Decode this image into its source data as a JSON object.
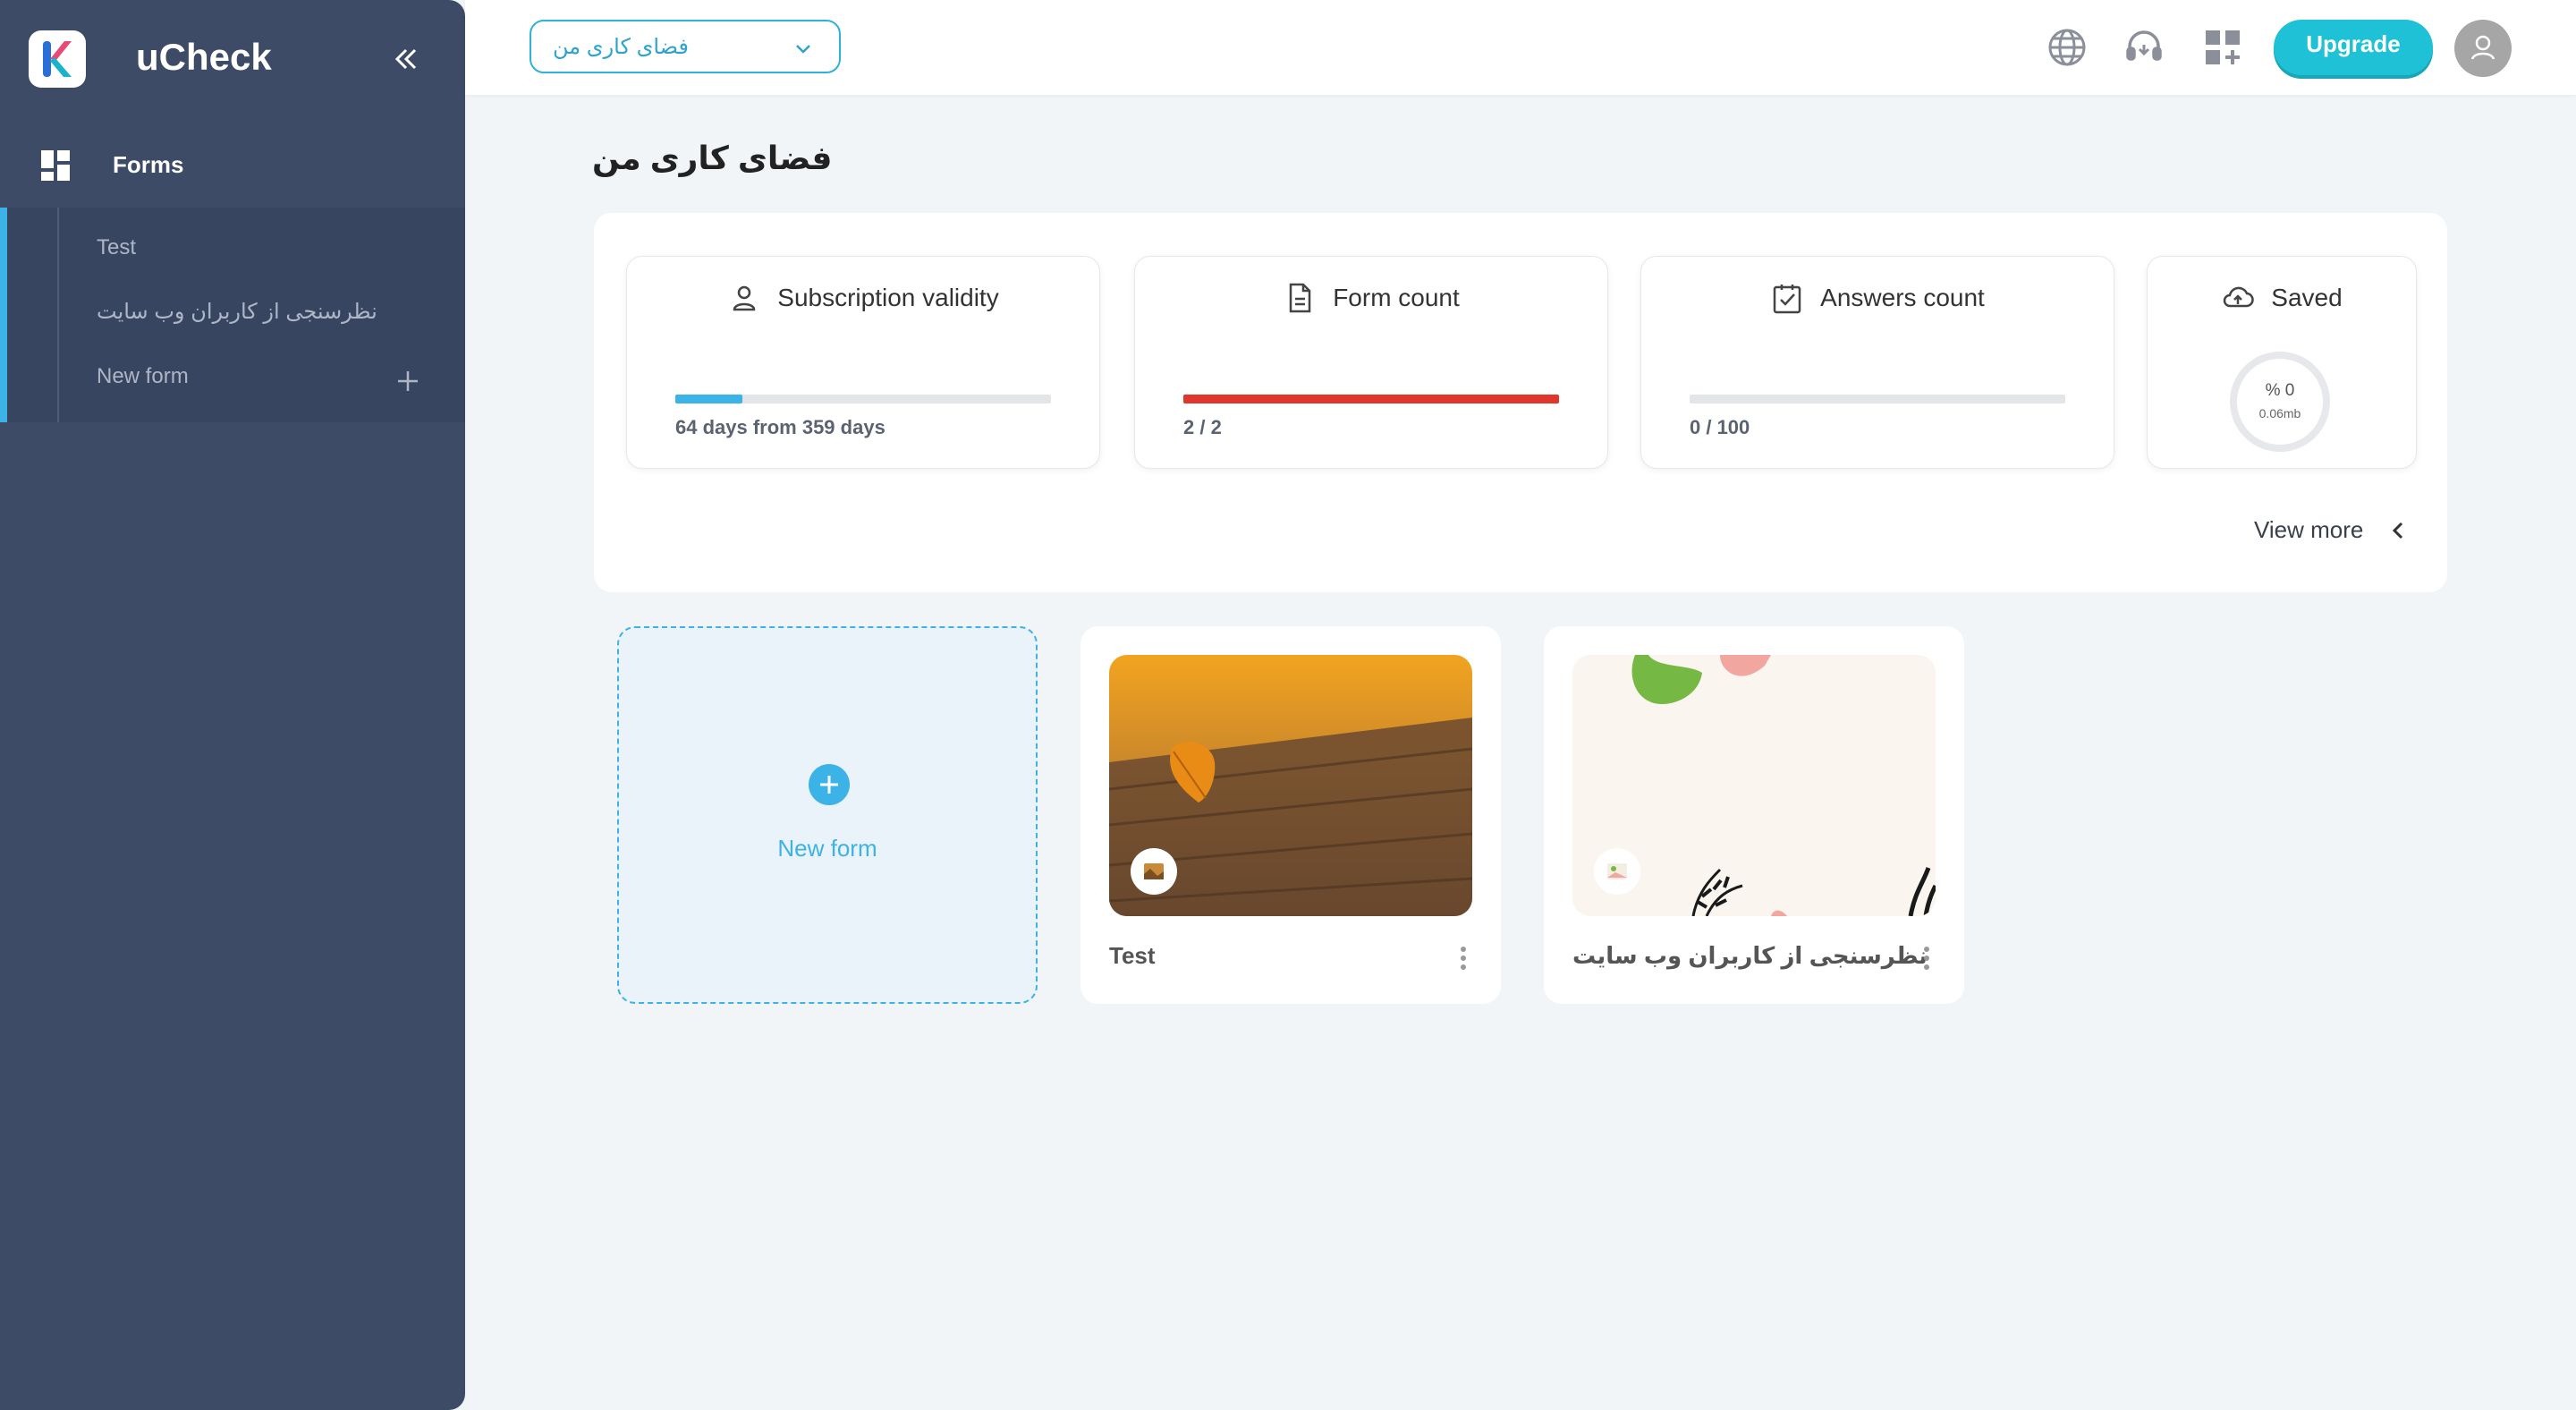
{
  "app": {
    "name": "uCheck"
  },
  "sidebar": {
    "main_item": "Forms",
    "sub_items": [
      {
        "label": "Test"
      },
      {
        "label": "نظرسنجی از کاربران وب سایت"
      },
      {
        "label": "New form"
      }
    ]
  },
  "topbar": {
    "workspace_select": "فضای کاری من",
    "upgrade_label": "Upgrade",
    "icons": [
      "globe-icon",
      "support-headset-icon",
      "apps-add-icon",
      "avatar-icon"
    ]
  },
  "page": {
    "title": "فضای کاری من"
  },
  "stats": {
    "subscription": {
      "title": "Subscription validity",
      "text": "64 days from 359 days",
      "progress": 0.178,
      "color": "#3bb3e6"
    },
    "forms": {
      "title": "Form count",
      "text": "2 / 2",
      "progress": 1.0,
      "color": "#e0362b"
    },
    "answers": {
      "title": "Answers count",
      "text": "0 / 100",
      "progress": 0.0,
      "color": "#3bb3e6"
    },
    "saved": {
      "title": "Saved",
      "percent": "% 0",
      "size": "0.06mb"
    },
    "view_more": "View more"
  },
  "new_form_card": {
    "label": "New form"
  },
  "forms": [
    {
      "name": "Test"
    },
    {
      "name": "نظرسنجی از کاربران وب سایت"
    }
  ],
  "colors": {
    "sidebar": "#3d4b66",
    "accent": "#3bb3e6",
    "upgrade": "#1fc1d6"
  }
}
